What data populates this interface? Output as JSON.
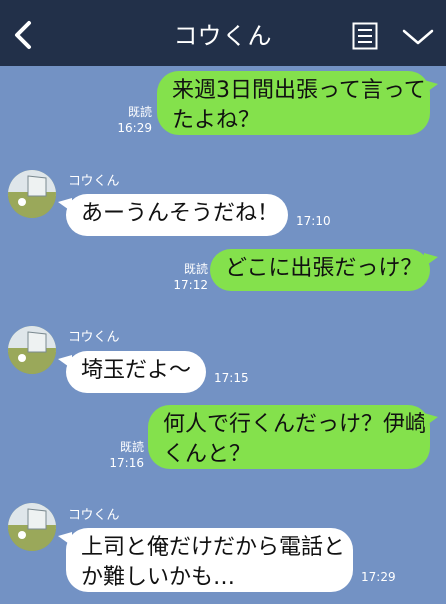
{
  "header": {
    "title": "コウくん",
    "back_icon": "chevron-left-icon",
    "menu_icon": "note-list-icon",
    "expand_icon": "chevron-down-icon",
    "bg_color": "#223049"
  },
  "chat_bg_color": "#7392c4",
  "sent_bubble_color": "#84e14c",
  "received_bubble_color": "#ffffff",
  "messages": [
    {
      "direction": "sent",
      "text_lines": [
        "来週3日間出張って言って",
        "たよね？"
      ],
      "read": "既読",
      "time": "16:29"
    },
    {
      "direction": "received",
      "sender": "コウくん",
      "text_lines": [
        "あーうんそうだね！"
      ],
      "time": "17:10"
    },
    {
      "direction": "sent",
      "text_lines": [
        "どこに出張だっけ？"
      ],
      "read": "既読",
      "time": "17:12"
    },
    {
      "direction": "received",
      "sender": "コウくん",
      "text_lines": [
        "埼玉だよ〜"
      ],
      "time": "17:15"
    },
    {
      "direction": "sent",
      "text_lines": [
        "何人で行くんだっけ？伊崎",
        "くんと？"
      ],
      "read": "既読",
      "time": "17:16"
    },
    {
      "direction": "received",
      "sender": "コウくん",
      "text_lines": [
        "上司と俺だけだから電話と",
        "か難しいかも…"
      ],
      "time": "17:29"
    }
  ]
}
